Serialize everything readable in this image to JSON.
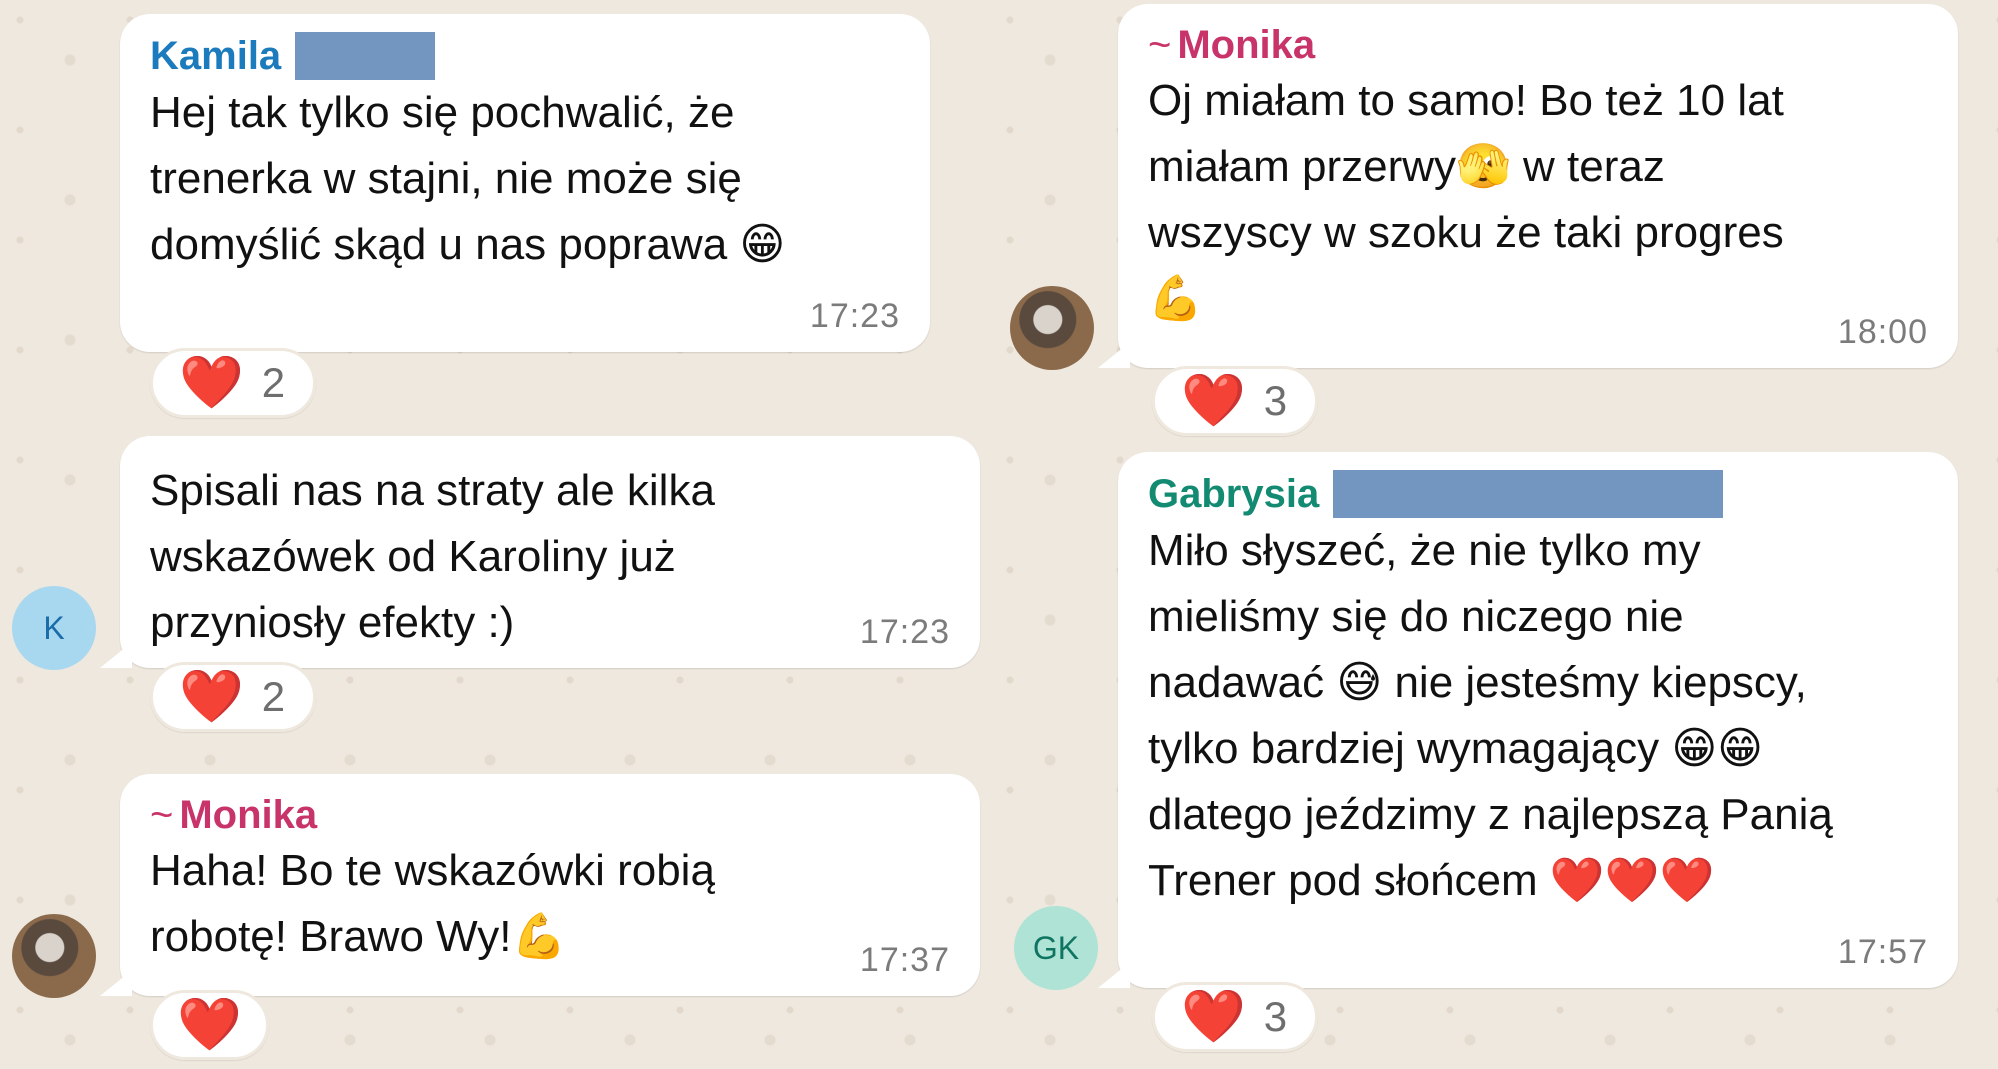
{
  "colors": {
    "kamila": "#1b7bbd",
    "monika": "#c8346a",
    "gabrysia": "#138a72",
    "heart": "#e0242e",
    "redaction": "#7396c1"
  },
  "left": {
    "msg1": {
      "sender": "Kamila",
      "text": "Hej tak tylko się pochwalić, że\ntrenerka w stajni, nie może się\ndomyślić skąd u nas poprawa 😁",
      "time": "17:23",
      "reaction": {
        "emoji": "❤️",
        "count": "2"
      }
    },
    "msg2": {
      "text": "Spisali nas na straty ale kilka\nwskazówek od Karoliny już\nprzyniosły efekty :)",
      "time": "17:23",
      "avatar": "K",
      "reaction": {
        "emoji": "❤️",
        "count": "2"
      }
    },
    "msg3": {
      "tilde": "~",
      "sender": "Monika",
      "text": "Haha! Bo te wskazówki robią\nrobotę! Brawo Wy!💪",
      "time": "17:37",
      "reaction": {
        "emoji": "❤️"
      }
    }
  },
  "right": {
    "msg1": {
      "tilde": "~",
      "sender": "Monika",
      "text": "Oj miałam to samo! Bo też 10 lat\nmiałam przerwy🫣 w teraz\nwszyscy w szoku że taki progres\n💪",
      "time": "18:00",
      "reaction": {
        "emoji": "❤️",
        "count": "3"
      }
    },
    "msg2": {
      "sender": "Gabrysia",
      "text": "Miło słyszeć, że nie tylko my\nmieliśmy się do niczego nie\nnadawać 😅 nie jesteśmy kiepscy,\ntylko bardziej wymagający 😁😁\ndlatego jeździmy z najlepszą Panią\nTrener pod słońcem ❤️❤️❤️",
      "time": "17:57",
      "avatar": "GK",
      "reaction": {
        "emoji": "❤️",
        "count": "3"
      }
    }
  }
}
